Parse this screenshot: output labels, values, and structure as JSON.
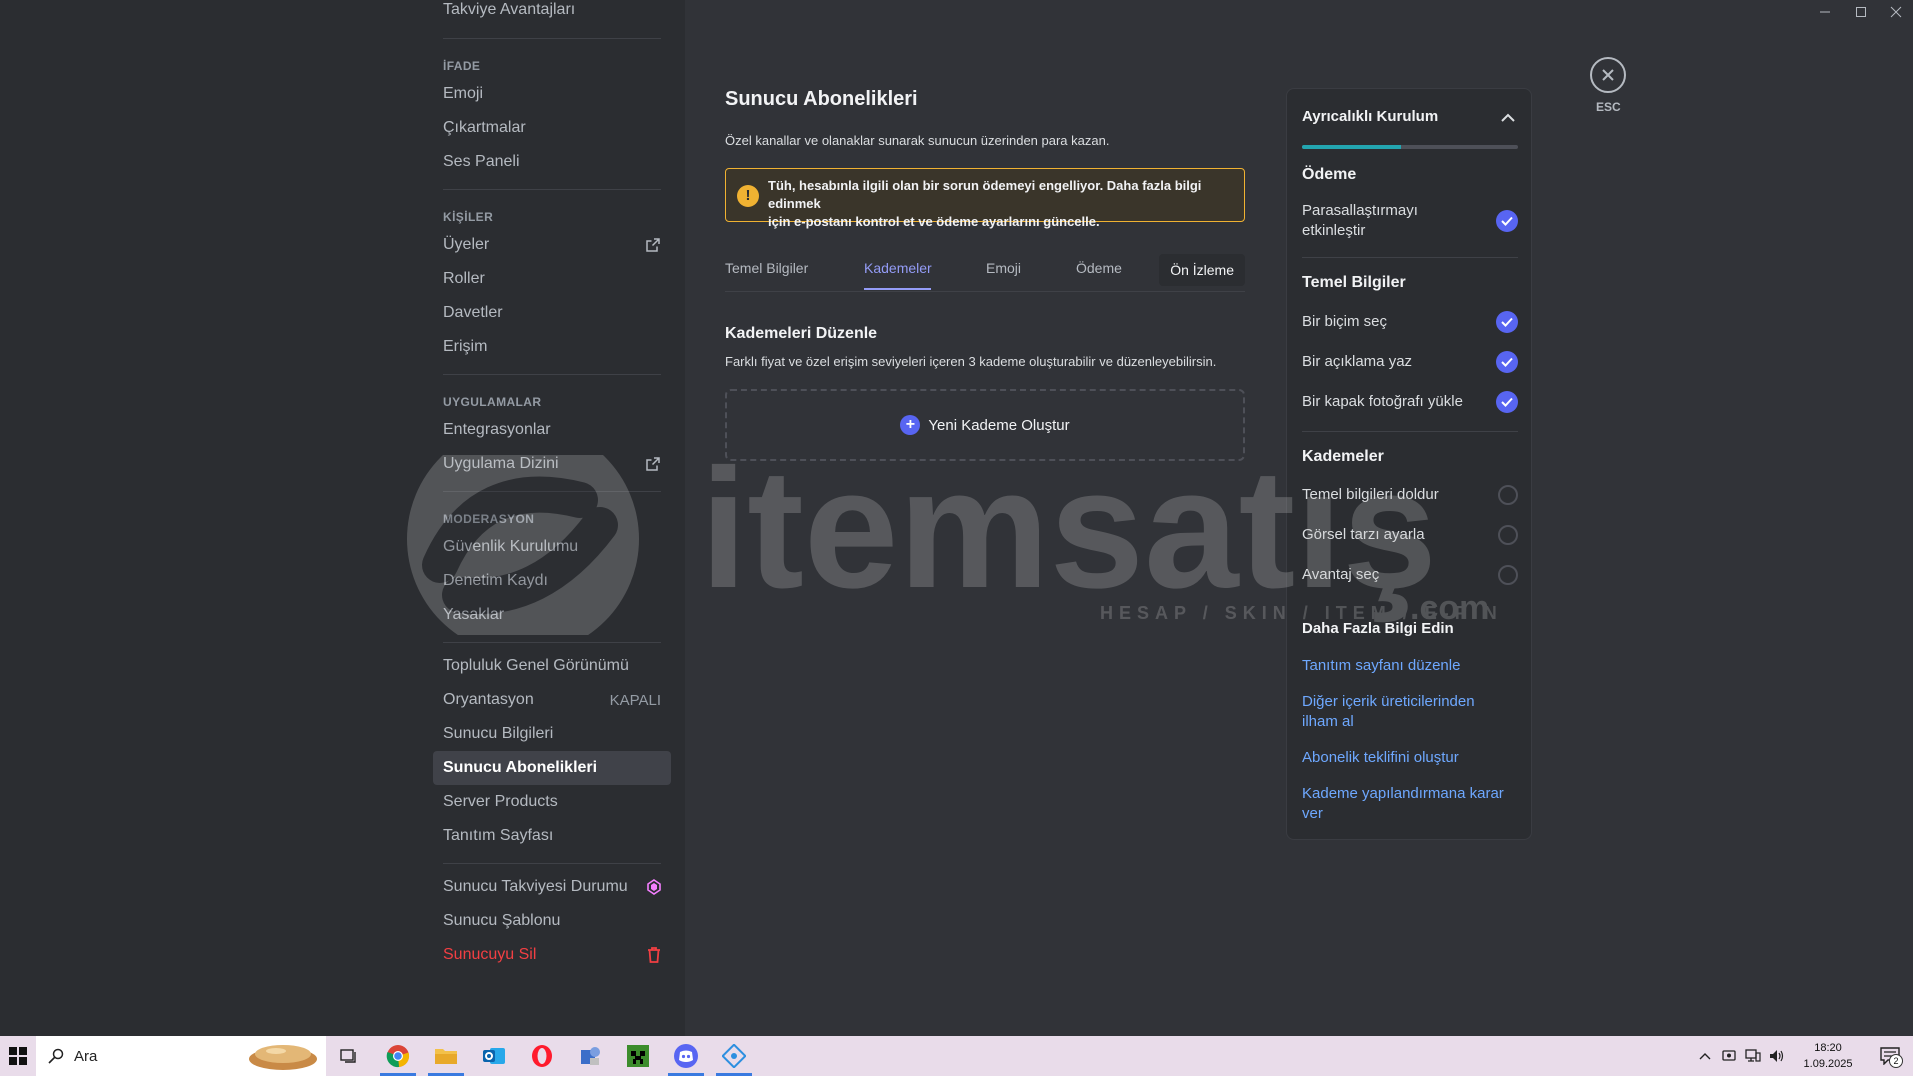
{
  "sidebar": {
    "top_item": "Takviye Avantajları",
    "groups": [
      {
        "header": "İFADE",
        "items": [
          "Emoji",
          "Çıkartmalar",
          "Ses Paneli"
        ]
      },
      {
        "header": "KİŞİLER",
        "items": [
          "Üyeler",
          "Roller",
          "Davetler",
          "Erişim"
        ]
      },
      {
        "header": "UYGULAMALAR",
        "items": [
          "Entegrasyonlar",
          "Uygulama Dizini"
        ]
      },
      {
        "header": "MODERASYON",
        "items": [
          "Güvenlik Kurulumu",
          "Denetim Kaydı",
          "Yasaklar"
        ]
      }
    ],
    "community": [
      "Topluluk Genel Görünümü",
      "Oryantasyon",
      "Sunucu Bilgileri",
      "Sunucu Abonelikleri",
      "Server Products",
      "Tanıtım Sayfası"
    ],
    "onboarding_status": "KAPALI",
    "bottom": [
      "Sunucu Takviyesi Durumu",
      "Sunucu Şablonu",
      "Sunucuyu Sil"
    ]
  },
  "main": {
    "title": "Sunucu Abonelikleri",
    "description": "Özel kanallar ve olanaklar sunarak sunucun üzerinden para kazan.",
    "warning_line1": "Tüh, hesabınla ilgili olan bir sorun ödemeyi engelliyor. Daha fazla bilgi edinmek",
    "warning_line2": "için e-postanı kontrol et ve ödeme ayarlarını güncelle.",
    "tabs": [
      "Temel Bilgiler",
      "Kademeler",
      "Emoji",
      "Ödeme"
    ],
    "preview_tab": "Ön İzleme",
    "section_title": "Kademeleri Düzenle",
    "section_desc": "Farklı fiyat ve özel erişim seviyeleri içeren 3 kademe oluşturabilir ve düzenleyebilirsin.",
    "new_tier_label": "Yeni Kademe Oluştur"
  },
  "panel": {
    "title": "Ayrıcalıklı Kurulum",
    "progress": 0.46,
    "groups": [
      {
        "title": "Ödeme",
        "items": [
          {
            "label_1": "Parasallaştırmayı",
            "label_2": "etkinleştir",
            "done": true
          }
        ]
      },
      {
        "title": "Temel Bilgiler",
        "items": [
          {
            "label": "Bir biçim seç",
            "done": true
          },
          {
            "label": "Bir açıklama yaz",
            "done": true
          },
          {
            "label": "Bir kapak fotoğrafı yükle",
            "done": true
          }
        ]
      },
      {
        "title": "Kademeler",
        "items": [
          {
            "label": "Temel bilgileri doldur",
            "done": false
          },
          {
            "label": "Görsel tarzı ayarla",
            "done": false
          },
          {
            "label": "Avantaj seç",
            "done": false
          }
        ]
      }
    ],
    "learn_title": "Daha Fazla Bilgi Edin",
    "links": [
      {
        "l1": "Tanıtım sayfanı düzenle",
        "l2": ""
      },
      {
        "l1": "Diğer içerik üreticilerinden",
        "l2": "ilham al"
      },
      {
        "l1": "Abonelik teklifini oluştur",
        "l2": ""
      },
      {
        "l1": "Kademe yapılandırmana karar",
        "l2": "ver"
      }
    ]
  },
  "close_label": "ESC",
  "watermark": {
    "brand": "itemsatış",
    "tagline": "HESAP / SKIN / ITEM / E-PIN",
    "suffix": ".com"
  },
  "taskbar": {
    "search_placeholder": "Ara",
    "apps": [
      "task-view-icon",
      "chrome-icon",
      "file-explorer-icon",
      "outlook-icon",
      "opera-icon",
      "app-icon",
      "minecraft-icon",
      "discord-icon",
      "network-app-icon"
    ],
    "time": "18:20",
    "date": "1.09.2025",
    "notification_count": "2"
  },
  "colors": {
    "accent": "#5865f2",
    "tab_active": "#949cf7",
    "progress": "#23a5b0",
    "danger": "#f23f43",
    "warning": "#f0b232"
  }
}
